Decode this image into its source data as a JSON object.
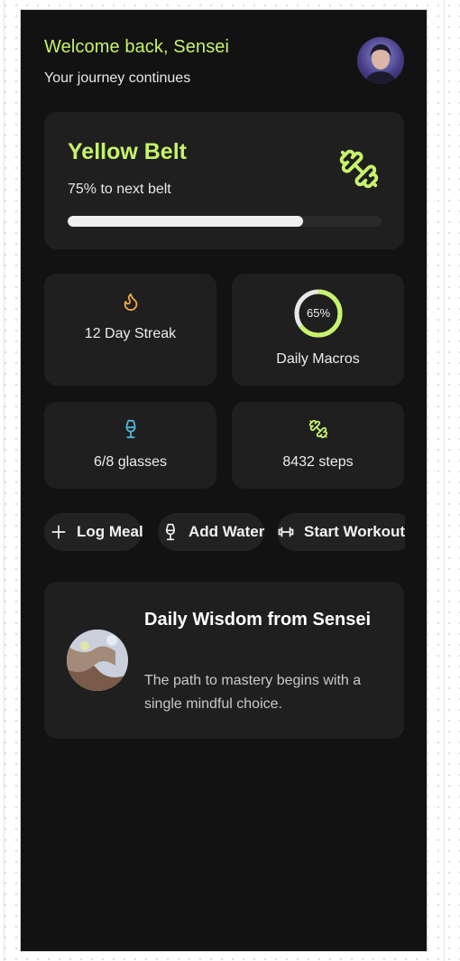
{
  "header": {
    "welcome": "Welcome back, Sensei",
    "subtitle": "Your journey continues",
    "avatar_icon": "user-avatar"
  },
  "belt": {
    "title": "Yellow Belt",
    "progress_text": "75% to next belt",
    "progress": 0.75,
    "icon": "dumbbell-icon",
    "accent": "#c6f36b"
  },
  "stats": {
    "streak": {
      "label": "12 Day Streak",
      "icon": "flame-icon",
      "color": "#f4a940"
    },
    "macros": {
      "label": "Daily Macros",
      "percent_text": "65%",
      "percent": 0.65,
      "color": "#c6f36b"
    },
    "water": {
      "label": "6/8 glasses",
      "icon": "glass-icon",
      "color": "#4fb3d9"
    },
    "steps": {
      "label": "8432 steps",
      "icon": "dumbbell-icon",
      "color": "#c6f36b"
    }
  },
  "actions": [
    {
      "label": "Log Meal",
      "icon": "plus-icon"
    },
    {
      "label": "Add Water",
      "icon": "glass-icon"
    },
    {
      "label": "Start Workout",
      "icon": "dumbbell-icon"
    }
  ],
  "wisdom": {
    "title": "Daily Wisdom from Sensei",
    "text": "The path to mastery begins with a single mindful choice."
  }
}
